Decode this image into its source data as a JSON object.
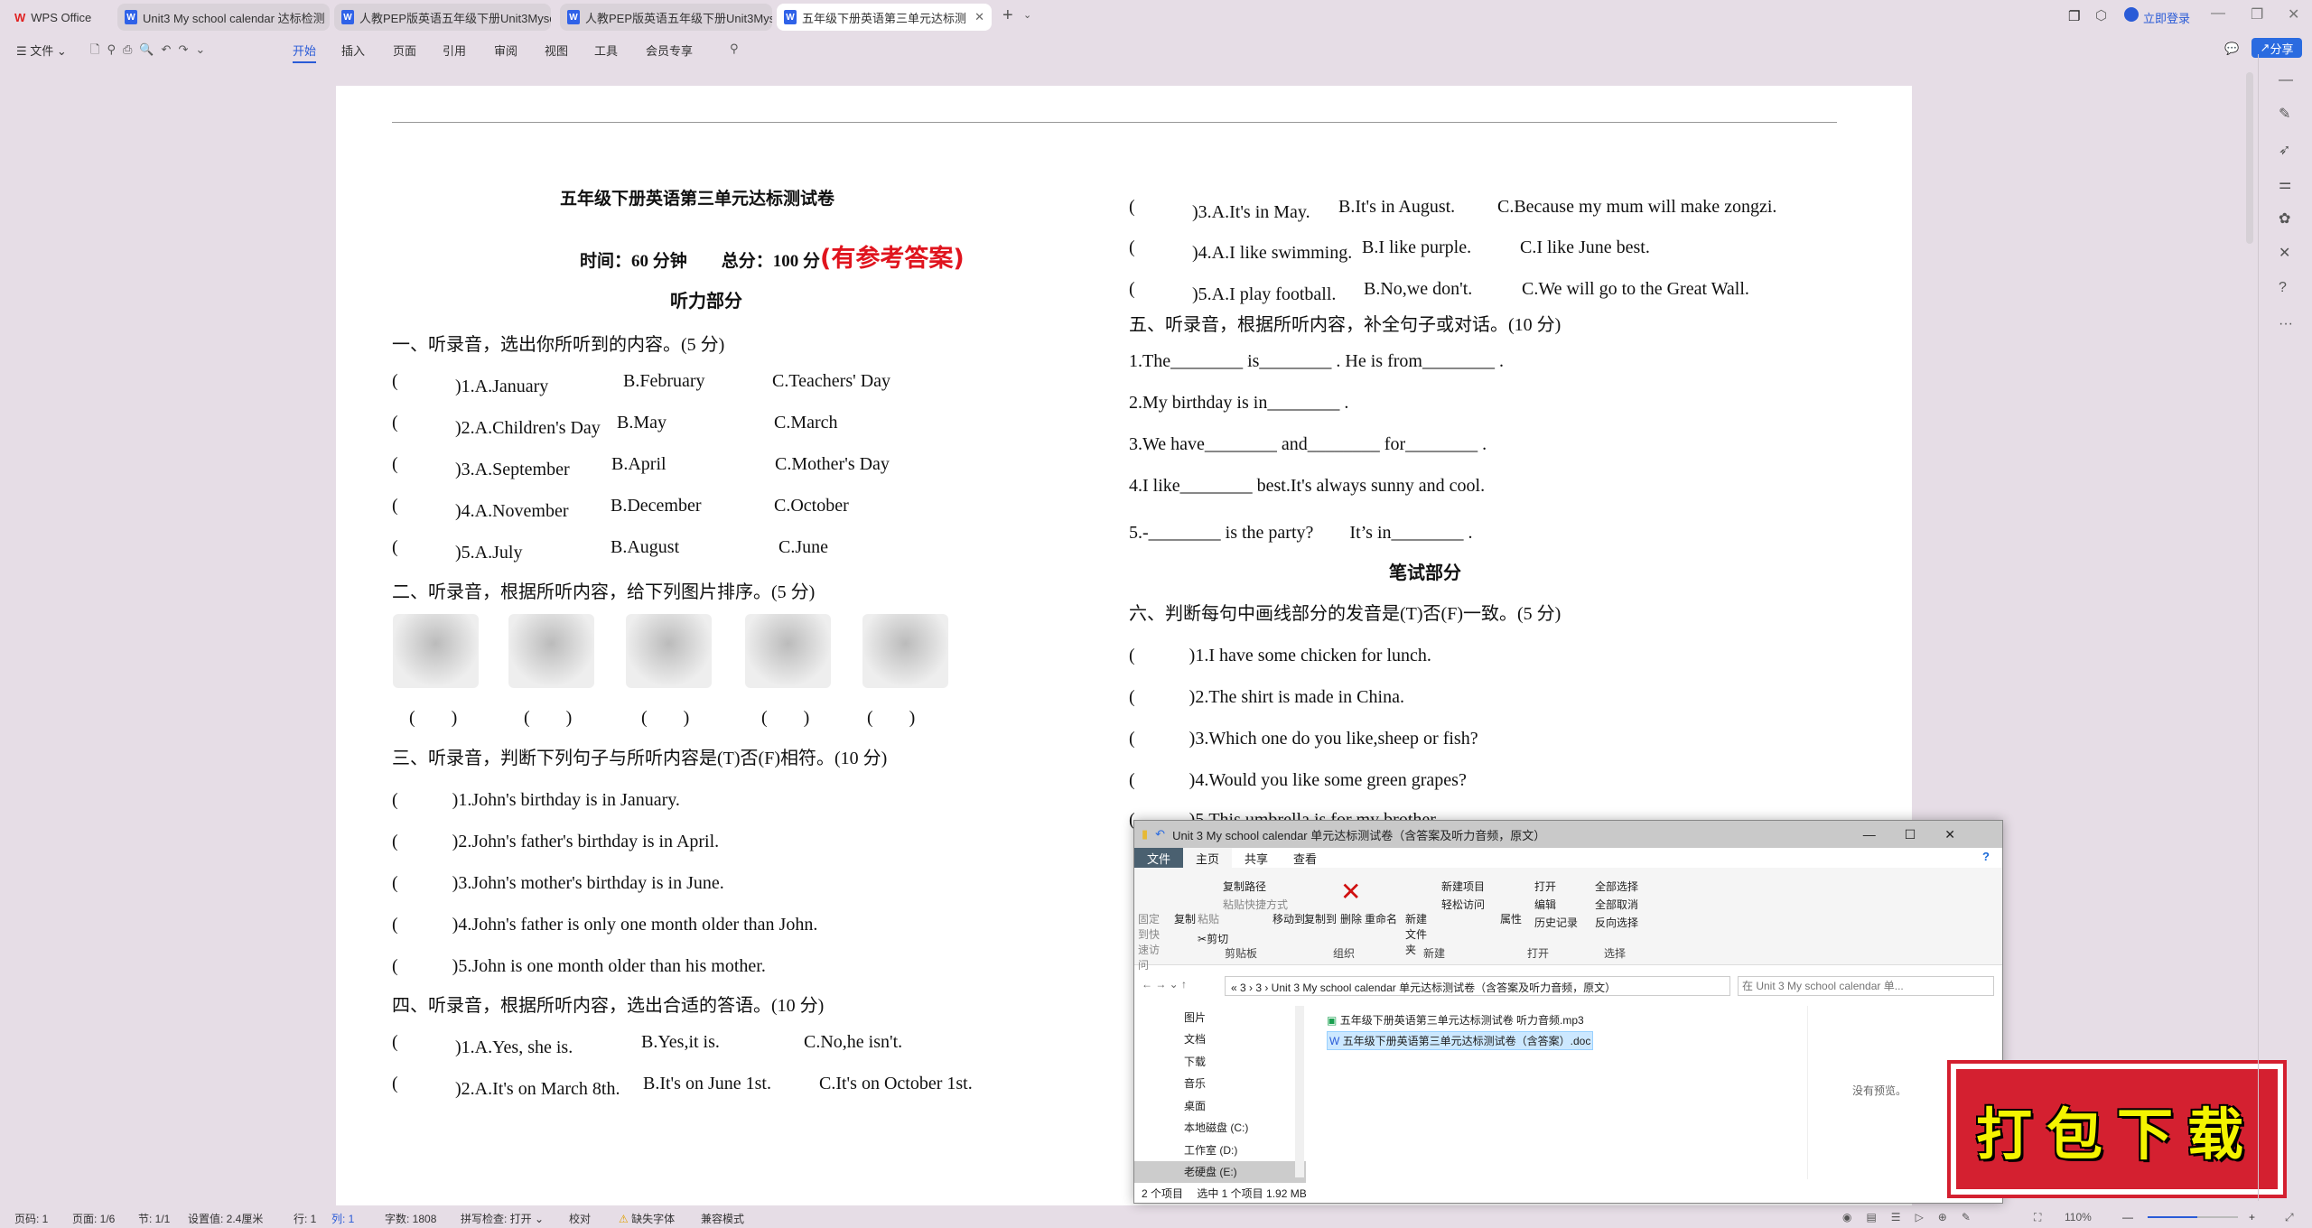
{
  "tabs": [
    {
      "label": "WPS Office",
      "icon": "wps-logo"
    },
    {
      "label": "Unit3  My school calendar 达标检测"
    },
    {
      "label": "人教PEP版英语五年级下册Unit3Mysc"
    },
    {
      "label": "人教PEP版英语五年级下册Unit3Mysc"
    },
    {
      "label": "五年级下册英语第三单元达标测",
      "active": true
    }
  ],
  "titlebar": {
    "login": "立即登录",
    "share": "分享"
  },
  "toolbar": {
    "file": "文件",
    "menus": [
      "开始",
      "插入",
      "页面",
      "引用",
      "审阅",
      "视图",
      "工具",
      "会员专享"
    ],
    "active": "开始"
  },
  "doc": {
    "title": "五年级下册英语第三单元达标测试卷",
    "meta": "时间：60 分钟　　总分：100 分",
    "answer_note": "(有参考答案)",
    "listening_heading": "听力部分",
    "s1": {
      "heading": "一、听录音，选出你所听到的内容。(5 分)",
      "rows": [
        [
          "(",
          "　)1.A.January",
          "B.February",
          "C.Teachers' Day"
        ],
        [
          "(",
          "　)2.A.Children's Day",
          "B.May",
          "C.March"
        ],
        [
          "(",
          "　)3.A.September",
          "B.April",
          "C.Mother's Day"
        ],
        [
          "(",
          "　)4.A.November",
          "B.December",
          "C.October"
        ],
        [
          "(",
          "　)5.A.July",
          "B.August",
          "C.June"
        ]
      ]
    },
    "s2": {
      "heading": "二、听录音，根据所听内容，给下列图片排序。(5 分)",
      "blanks": [
        "(　　)",
        "(　　)",
        "(　　)",
        "(　　)",
        "(　　)"
      ]
    },
    "s3": {
      "heading": "三、听录音，判断下列句子与所听内容是(T)否(F)相符。(10 分)",
      "rows": [
        "(　　　)1.John's birthday is in January.",
        "(　　　)2.John's father's birthday is in April.",
        "(　　　)3.John's mother's birthday is in June.",
        "(　　　)4.John's father is only one month older than John.",
        "(　　　)5.John is one month older than his mother."
      ]
    },
    "s4": {
      "heading": "四、听录音，根据所听内容，选出合适的答语。(10 分)",
      "rows": [
        [
          "(",
          "　)1.A.Yes, she is.",
          "B.Yes,it is.",
          "C.No,he isn't."
        ],
        [
          "(",
          "　)2.A.It's on March 8th.",
          "B.It's on June 1st.",
          "C.It's on October 1st."
        ],
        [
          "(",
          "　)3.A.It's in May.",
          "B.It's in August.",
          "C.Because my mum will make zongzi."
        ],
        [
          "(",
          "　)4.A.I like swimming.",
          "B.I like purple.",
          "C.I like June best."
        ],
        [
          "(",
          "　)5.A.I play football.",
          "B.No,we don't.",
          "C.We will go to the Great Wall."
        ]
      ]
    },
    "s5": {
      "heading": "五、听录音，根据所听内容，补全句子或对话。(10 分)",
      "rows": [
        "1.The________  is________ . He is from________ .",
        "2.My birthday is in________ .",
        "3.We have________  and________  for________ .",
        "4.I like________  best.It's always sunny and cool.",
        "5.-________  is the party?　　It’s in________ ."
      ]
    },
    "written_heading": "笔试部分",
    "s6": {
      "heading": "六、判断每句中画线部分的发音是(T)否(F)一致。(5 分)",
      "rows": [
        "(　　　)1.I have some chicken for lunch.",
        "(　　　)2.The shirt is made in China.",
        "(　　　)3.Which one do you like,sheep or fish?",
        "(　　　)4.Would you like some green grapes?",
        "(　　　)5.This umbrella is for my brother."
      ]
    }
  },
  "explorer": {
    "title": "Unit 3 My school calendar 单元达标测试卷（含答案及听力音频，原文）",
    "tabs": [
      "文件",
      "主页",
      "共享",
      "查看"
    ],
    "ribbon": {
      "pin": "固定到快速访问",
      "copy": "复制",
      "paste": "粘贴",
      "copy_path": "复制路径",
      "paste_shortcut": "粘贴快捷方式",
      "cut": "剪切",
      "move_to": "移动到",
      "copy_to": "复制到",
      "delete": "删除",
      "rename": "重命名",
      "new_folder": "新建文件夹",
      "new_item": "新建项目",
      "easy_access": "轻松访问",
      "properties": "属性",
      "open": "打开",
      "edit": "编辑",
      "history": "历史记录",
      "select_all": "全部选择",
      "select_none": "全部取消",
      "invert": "反向选择",
      "groups": [
        "剪贴板",
        "组织",
        "新建",
        "打开",
        "选择"
      ]
    },
    "address": "« 3 › 3 › Unit 3 My school calendar 单元达标测试卷（含答案及听力音频，原文）",
    "search_placeholder": "在 Unit 3 My school calendar 单...",
    "nav": [
      "图片",
      "文档",
      "下载",
      "音乐",
      "桌面",
      "本地磁盘 (C:)",
      "工作室 (D:)",
      "老硬盘 (E:)"
    ],
    "files": [
      "五年级下册英语第三单元达标测试卷 听力音频.mp3",
      "五年级下册英语第三单元达标测试卷（含答案）.doc"
    ],
    "preview": "没有预览。",
    "status": "2 个项目　 选中 1 个项目  1.92 MB"
  },
  "stamp": "打包下载",
  "statusbar": {
    "items": [
      "页码: 1",
      "页面: 1/6",
      "节: 1/1",
      "设置值: 2.4厘米",
      "行: 1",
      "列: 1",
      "字数: 1808",
      "拼写检查: 打开 ⌄",
      "校对",
      "缺失字体",
      "兼容模式"
    ],
    "zoom": "110%",
    "zoom_level": 0.55
  }
}
